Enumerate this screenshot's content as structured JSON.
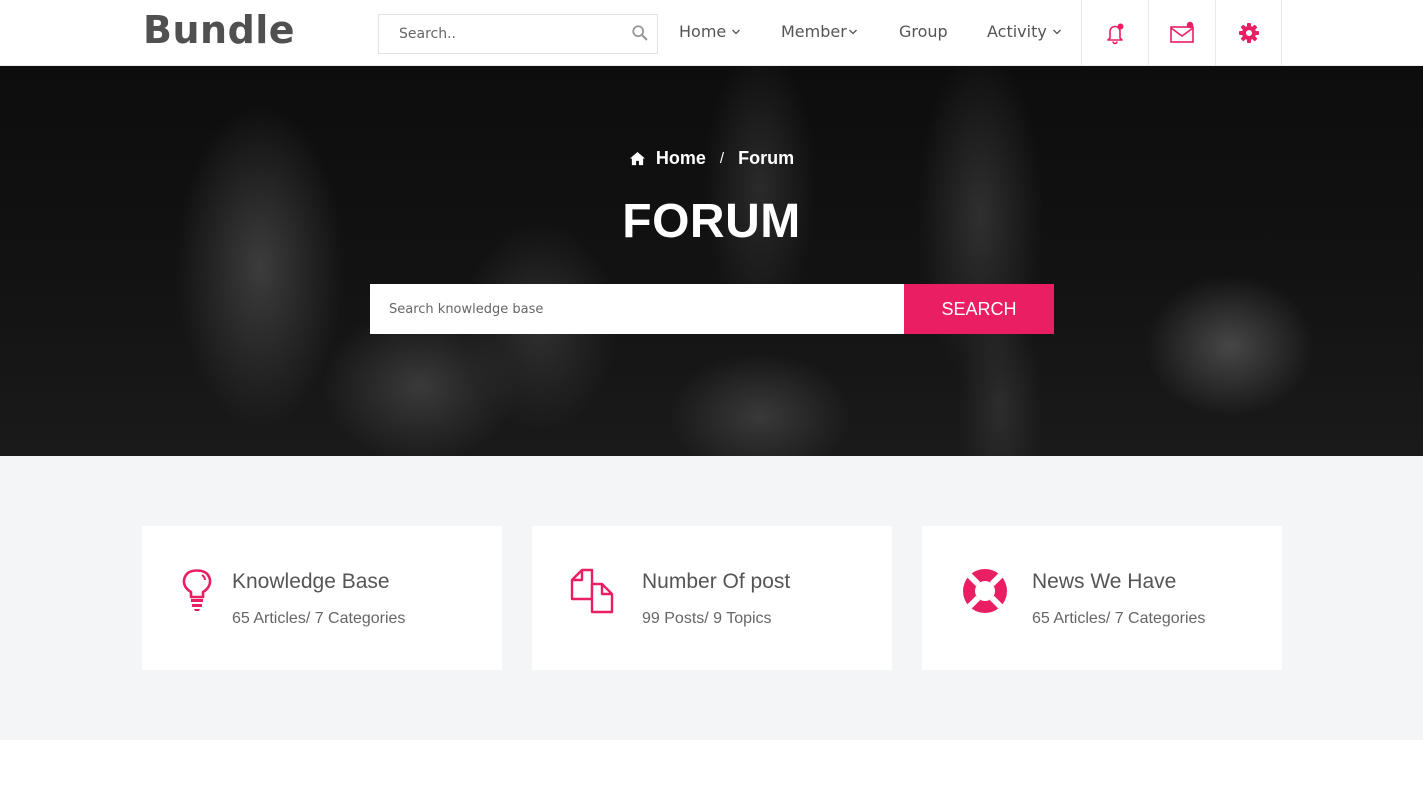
{
  "header": {
    "logo": "Bundle",
    "search_placeholder": "Search..",
    "nav": [
      {
        "label": "Home",
        "has_dropdown": true
      },
      {
        "label": "Member",
        "has_dropdown": true
      },
      {
        "label": "Group",
        "has_dropdown": false
      },
      {
        "label": "Activity",
        "has_dropdown": true
      }
    ],
    "icons": [
      "bell-icon",
      "envelope-icon",
      "gear-icon"
    ]
  },
  "hero": {
    "breadcrumb": {
      "home": "Home",
      "separator": "/",
      "current": "Forum"
    },
    "title": "FORUM",
    "search_placeholder": "Search knowledge base",
    "search_button": "SEARCH"
  },
  "stats": [
    {
      "icon": "lightbulb-icon",
      "title": "Knowledge Base",
      "subtitle": "65 Articles/ 7 Categories"
    },
    {
      "icon": "documents-icon",
      "title": "Number Of post",
      "subtitle": "99 Posts/ 9 Topics"
    },
    {
      "icon": "lifebuoy-icon",
      "title": "News We Have",
      "subtitle": "65 Articles/ 7 Categories"
    }
  ],
  "colors": {
    "accent": "#e91e63",
    "text": "#555555",
    "section_bg": "#f4f5f7"
  }
}
